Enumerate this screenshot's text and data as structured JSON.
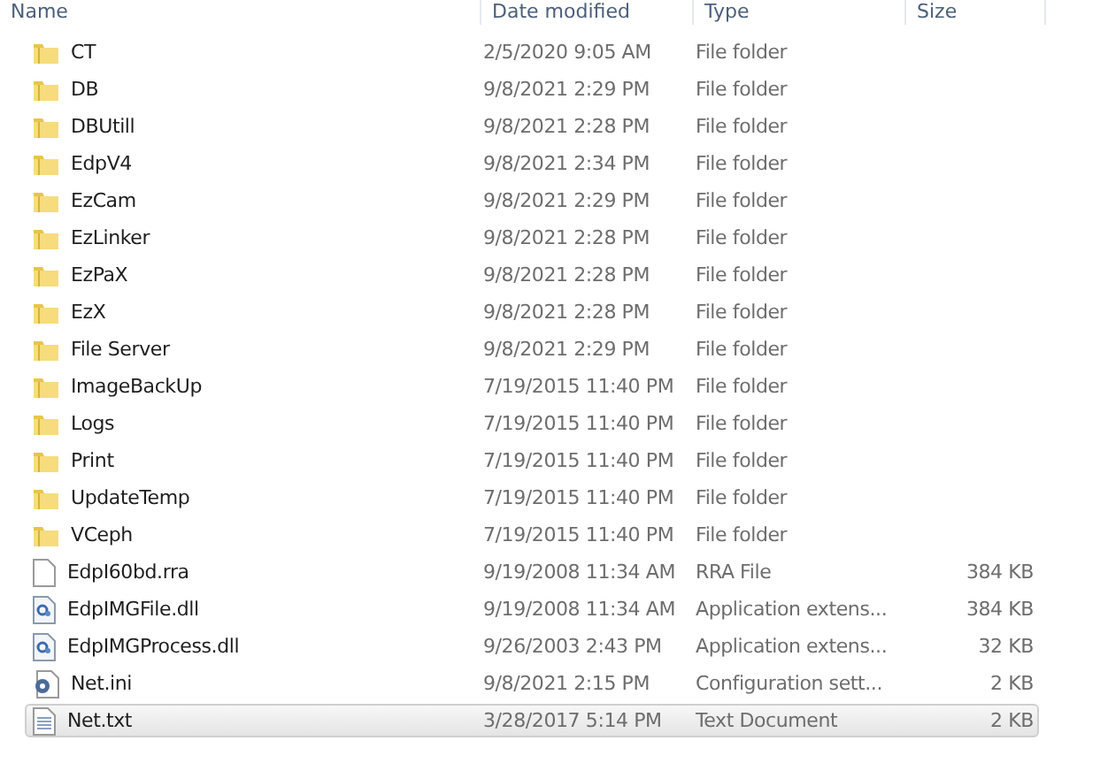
{
  "columns": [
    "Name",
    "Date modified",
    "Type",
    "Size"
  ],
  "rows": [
    {
      "kind": "folder",
      "name": "CT",
      "date": "2/5/2020 9:05 AM",
      "type": "File folder",
      "size": "",
      "selected": false
    },
    {
      "kind": "folder",
      "name": "DB",
      "date": "9/8/2021 2:29 PM",
      "type": "File folder",
      "size": "",
      "selected": false
    },
    {
      "kind": "folder",
      "name": "DBUtill",
      "date": "9/8/2021 2:28 PM",
      "type": "File folder",
      "size": "",
      "selected": false
    },
    {
      "kind": "folder",
      "name": "EdpV4",
      "date": "9/8/2021 2:34 PM",
      "type": "File folder",
      "size": "",
      "selected": false
    },
    {
      "kind": "folder",
      "name": "EzCam",
      "date": "9/8/2021 2:29 PM",
      "type": "File folder",
      "size": "",
      "selected": false
    },
    {
      "kind": "folder",
      "name": "EzLinker",
      "date": "9/8/2021 2:28 PM",
      "type": "File folder",
      "size": "",
      "selected": false
    },
    {
      "kind": "folder",
      "name": "EzPaX",
      "date": "9/8/2021 2:28 PM",
      "type": "File folder",
      "size": "",
      "selected": false
    },
    {
      "kind": "folder",
      "name": "EzX",
      "date": "9/8/2021 2:28 PM",
      "type": "File folder",
      "size": "",
      "selected": false
    },
    {
      "kind": "folder",
      "name": "File Server",
      "date": "9/8/2021 2:29 PM",
      "type": "File folder",
      "size": "",
      "selected": false
    },
    {
      "kind": "folder",
      "name": "ImageBackUp",
      "date": "7/19/2015 11:40 PM",
      "type": "File folder",
      "size": "",
      "selected": false
    },
    {
      "kind": "folder",
      "name": "Logs",
      "date": "7/19/2015 11:40 PM",
      "type": "File folder",
      "size": "",
      "selected": false
    },
    {
      "kind": "folder",
      "name": "Print",
      "date": "7/19/2015 11:40 PM",
      "type": "File folder",
      "size": "",
      "selected": false
    },
    {
      "kind": "folder",
      "name": "UpdateTemp",
      "date": "7/19/2015 11:40 PM",
      "type": "File folder",
      "size": "",
      "selected": false
    },
    {
      "kind": "folder",
      "name": "VCeph",
      "date": "7/19/2015 11:40 PM",
      "type": "File folder",
      "size": "",
      "selected": false
    },
    {
      "kind": "file",
      "name": "EdpI60bd.rra",
      "date": "9/19/2008 11:34 AM",
      "type": "RRA File",
      "size": "384 KB",
      "selected": false
    },
    {
      "kind": "dll",
      "name": "EdpIMGFile.dll",
      "date": "9/19/2008 11:34 AM",
      "type": "Application extens...",
      "size": "384 KB",
      "selected": false
    },
    {
      "kind": "dll",
      "name": "EdpIMGProcess.dll",
      "date": "9/26/2003 2:43 PM",
      "type": "Application extens...",
      "size": "32 KB",
      "selected": false
    },
    {
      "kind": "ini",
      "name": "Net.ini",
      "date": "9/8/2021 2:15 PM",
      "type": "Configuration sett...",
      "size": "2 KB",
      "selected": false
    },
    {
      "kind": "txt",
      "name": "Net.txt",
      "date": "3/28/2017 5:14 PM",
      "type": "Text Document",
      "size": "2 KB",
      "selected": true
    }
  ]
}
